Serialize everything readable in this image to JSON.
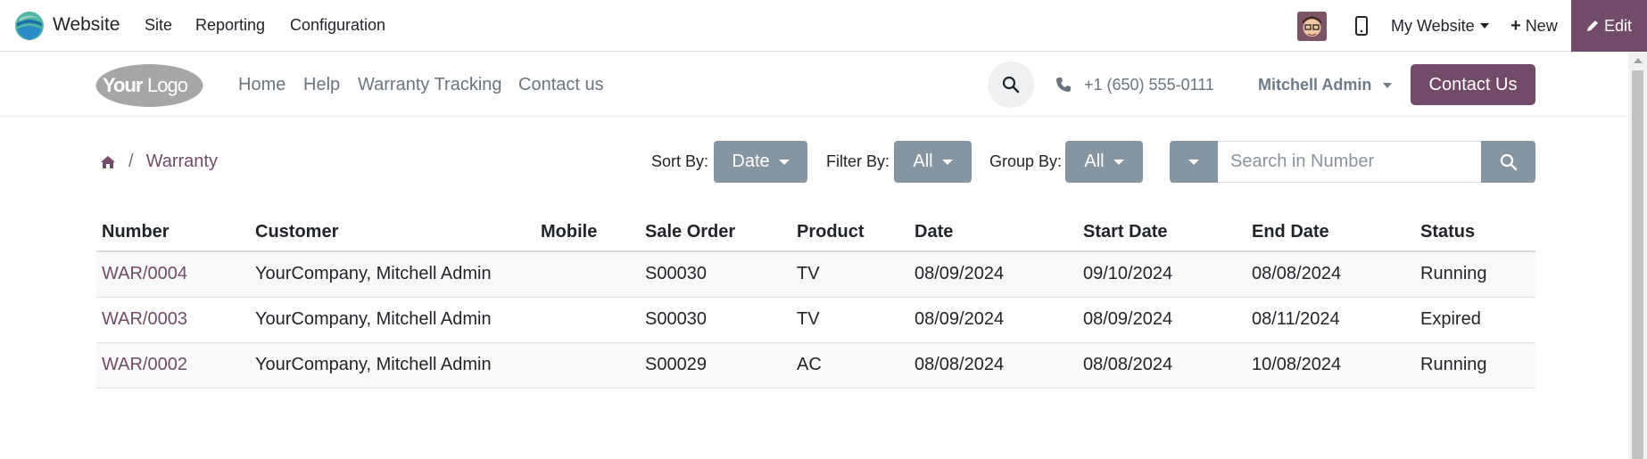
{
  "admin_bar": {
    "app_name": "Website",
    "menu": [
      "Site",
      "Reporting",
      "Configuration"
    ],
    "website_selector": "My Website",
    "new_label": "New",
    "edit_label": "Edit"
  },
  "site_header": {
    "logo_text": "YourLogo",
    "nav": [
      "Home",
      "Help",
      "Warranty Tracking",
      "Contact us"
    ],
    "phone": "+1 (650) 555-0111",
    "user": "Mitchell Admin",
    "contact_button": "Contact Us"
  },
  "toolbar": {
    "breadcrumb_current": "Warranty",
    "sort_label": "Sort By:",
    "sort_value": "Date",
    "filter_label": "Filter By:",
    "filter_value": "All",
    "group_label": "Group By:",
    "group_value": "All",
    "search_placeholder": "Search in Number"
  },
  "table": {
    "headers": [
      "Number",
      "Customer",
      "Mobile",
      "Sale Order",
      "Product",
      "Date",
      "Start Date",
      "End Date",
      "Status"
    ],
    "rows": [
      {
        "number": "WAR/0004",
        "customer": "YourCompany, Mitchell Admin",
        "mobile": "",
        "sale_order": "S00030",
        "product": "TV",
        "date": "08/09/2024",
        "start_date": "09/10/2024",
        "end_date": "08/08/2024",
        "status": "Running"
      },
      {
        "number": "WAR/0003",
        "customer": "YourCompany, Mitchell Admin",
        "mobile": "",
        "sale_order": "S00030",
        "product": "TV",
        "date": "08/09/2024",
        "start_date": "08/09/2024",
        "end_date": "08/11/2024",
        "status": "Expired"
      },
      {
        "number": "WAR/0002",
        "customer": "YourCompany, Mitchell Admin",
        "mobile": "",
        "sale_order": "S00029",
        "product": "AC",
        "date": "08/08/2024",
        "start_date": "08/08/2024",
        "end_date": "10/08/2024",
        "status": "Running"
      }
    ]
  },
  "colors": {
    "brand": "#714b67",
    "button_gray": "#8595a2"
  },
  "icons": [
    "odoo-website-logo-icon",
    "avatar",
    "mobile-preview-icon",
    "plus-icon",
    "pencil-icon",
    "search-icon",
    "phone-icon",
    "home-icon",
    "chevron-down-icon"
  ]
}
